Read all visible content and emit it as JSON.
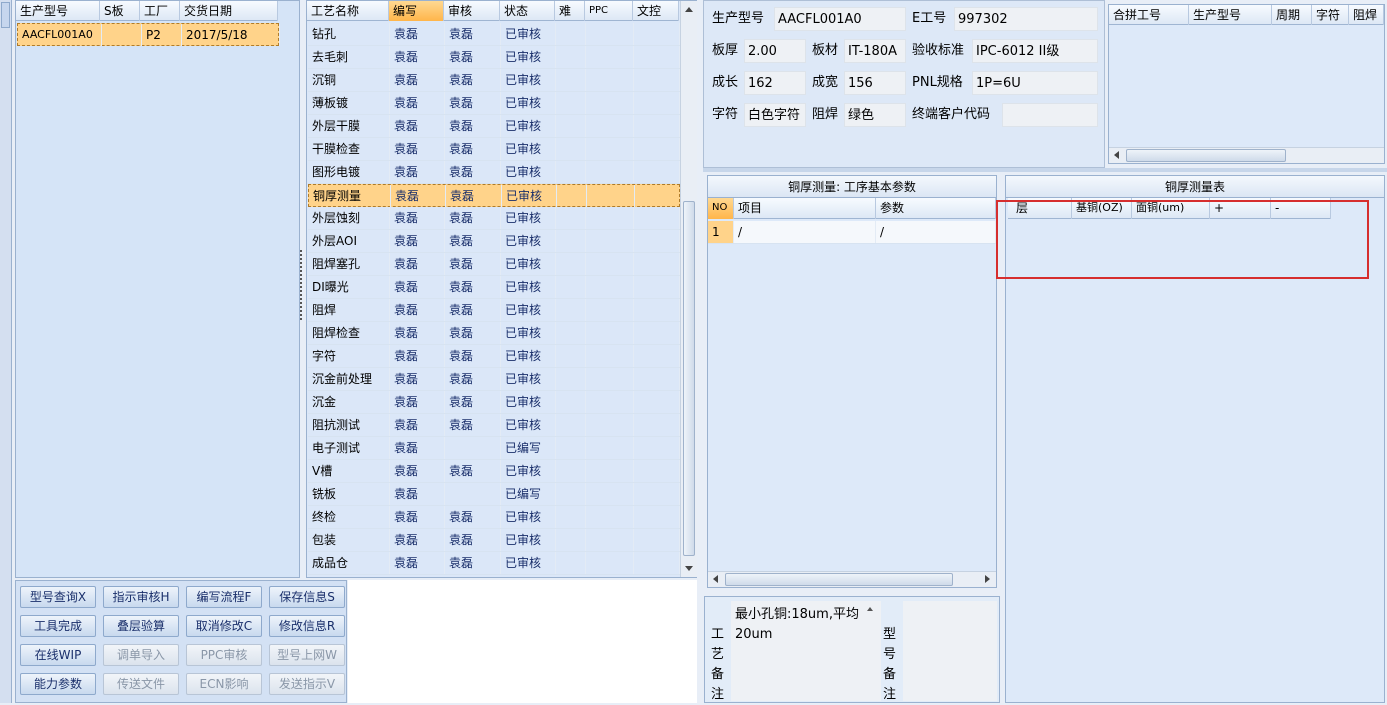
{
  "orders": {
    "columns": [
      "生产型号",
      "S板",
      "工厂",
      "交货日期"
    ],
    "rows": [
      {
        "model": "AACFL001A0",
        "s": "",
        "factory": "P2",
        "date": "2017/5/18"
      }
    ]
  },
  "process": {
    "columns": [
      "工艺名称",
      "编写",
      "审核",
      "状态",
      "难",
      "PPC",
      "文控"
    ],
    "rows": [
      [
        "钻孔",
        "袁磊",
        "袁磊",
        "已审核"
      ],
      [
        "去毛刺",
        "袁磊",
        "袁磊",
        "已审核"
      ],
      [
        "沉铜",
        "袁磊",
        "袁磊",
        "已审核"
      ],
      [
        "薄板镀",
        "袁磊",
        "袁磊",
        "已审核"
      ],
      [
        "外层干膜",
        "袁磊",
        "袁磊",
        "已审核"
      ],
      [
        "干膜检查",
        "袁磊",
        "袁磊",
        "已审核"
      ],
      [
        "图形电镀",
        "袁磊",
        "袁磊",
        "已审核"
      ],
      [
        "铜厚测量",
        "袁磊",
        "袁磊",
        "已审核"
      ],
      [
        "外层蚀刻",
        "袁磊",
        "袁磊",
        "已审核"
      ],
      [
        "外层AOI",
        "袁磊",
        "袁磊",
        "已审核"
      ],
      [
        "阻焊塞孔",
        "袁磊",
        "袁磊",
        "已审核"
      ],
      [
        "DI曝光",
        "袁磊",
        "袁磊",
        "已审核"
      ],
      [
        "阻焊",
        "袁磊",
        "袁磊",
        "已审核"
      ],
      [
        "阻焊检查",
        "袁磊",
        "袁磊",
        "已审核"
      ],
      [
        "字符",
        "袁磊",
        "袁磊",
        "已审核"
      ],
      [
        "沉金前处理",
        "袁磊",
        "袁磊",
        "已审核"
      ],
      [
        "沉金",
        "袁磊",
        "袁磊",
        "已审核"
      ],
      [
        "阻抗测试",
        "袁磊",
        "袁磊",
        "已审核"
      ],
      [
        "电子测试",
        "袁磊",
        "",
        "已编写"
      ],
      [
        "V槽",
        "袁磊",
        "袁磊",
        "已审核"
      ],
      [
        "铣板",
        "袁磊",
        "",
        "已编写"
      ],
      [
        "终检",
        "袁磊",
        "袁磊",
        "已审核"
      ],
      [
        "包装",
        "袁磊",
        "袁磊",
        "已审核"
      ],
      [
        "成品仓",
        "袁磊",
        "袁磊",
        "已审核"
      ]
    ]
  },
  "buttons": [
    [
      "型号查询X",
      "指示审核H",
      "编写流程F",
      "保存信息S"
    ],
    [
      "工具完成",
      "叠层验算",
      "取消修改C",
      "修改信息R"
    ],
    [
      "在线WIP",
      "调单导入",
      "PPC审核",
      "型号上网W"
    ],
    [
      "能力参数",
      "传送文件",
      "ECN影响",
      "发送指示V"
    ]
  ],
  "info": {
    "model_label": "生产型号",
    "model": "AACFL001A0",
    "e_label": "E工号",
    "e_no": "997302",
    "thick_label": "板厚",
    "thick": "2.00",
    "mat_label": "板材",
    "mat": "IT-180A",
    "std_label": "验收标准",
    "std": "IPC-6012 II级",
    "len_label": "成长",
    "len": "162",
    "wid_label": "成宽",
    "wid": "156",
    "pnl_label": "PNL规格",
    "pnl": "1P=6U",
    "char_label": "字符",
    "char": "白色字符",
    "mask_label": "阻焊",
    "mask": "绿色",
    "cust_label": "终端客户代码",
    "cust": ""
  },
  "merge": {
    "columns": [
      "合拼工号",
      "生产型号",
      "周期",
      "字符",
      "阻焊"
    ]
  },
  "params": {
    "title": "铜厚测量: 工序基本参数",
    "columns": [
      "NO",
      "项目",
      "参数"
    ],
    "rows": [
      [
        "1",
        "/",
        "/"
      ]
    ]
  },
  "measure": {
    "title": "铜厚测量表",
    "columns": [
      "层",
      "基铜(OZ)",
      "面铜(um)",
      "+",
      "-"
    ]
  },
  "notes": {
    "process_label": "工艺备注",
    "process_text": "最小孔铜:18um,平均20um",
    "model_label": "型号备注"
  },
  "colors": {
    "accent": "#ffb54a",
    "highlight": "#d62e2e",
    "text_blue": "#1a2f6b"
  }
}
